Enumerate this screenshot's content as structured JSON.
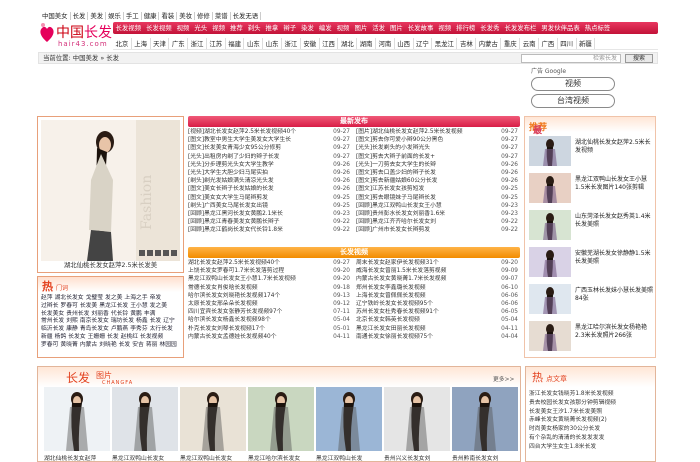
{
  "logo": {
    "cn_main": "中国",
    "cn_accent": "长发",
    "domain": "hair43.com"
  },
  "topnav": [
    "中国美女",
    "长发",
    "美发",
    "娱乐",
    "手工",
    "健康",
    "看装",
    "美妆",
    "修修",
    "菜谱",
    "长发无语"
  ],
  "nav2": [
    "长发视频",
    "长发视频",
    "视频",
    "光头",
    "视频",
    "推荐",
    "剃头",
    "推拿",
    "辫子",
    "染发",
    "编发",
    "视频",
    "图片",
    "活发",
    "图片",
    "长发故事",
    "视频",
    "排行榜",
    "长发秀",
    "长发发布栏",
    "男发伙伴品表",
    "热点标签"
  ],
  "nav3": [
    "北京",
    "上海",
    "天津",
    "广东",
    "浙江",
    "江苏",
    "福建",
    "山东",
    "山东",
    "浙江",
    "安徽",
    "江西",
    "湖北",
    "湖南",
    "河南",
    "山西",
    "辽宁",
    "黑龙江",
    "吉林",
    "内蒙古",
    "重庆",
    "云南",
    "广西",
    "四川",
    "新疆"
  ],
  "crumb": "当前位置: 中国美发 » 长发",
  "search": {
    "placeholder": "检索长发",
    "button": "搜索"
  },
  "ad": {
    "label": "广告 Google",
    "buttons": [
      "视频",
      "台湾视频"
    ]
  },
  "featured": {
    "caption": "湖北仙桃长发女赵萍2.5米长发美"
  },
  "sections": {
    "latest": "最新发布",
    "video": "长发视频"
  },
  "latest_left": [
    [
      "[视频]湖北长发女赵萍2.5米长发视频40个",
      "09-27"
    ],
    [
      "[图文]教室中男生大学生美发女大学生长",
      "09-27"
    ],
    [
      "[图文]长发美女青海少女95公分修剪",
      "09-27"
    ],
    [
      "[光头]出租房内剃了少妇的辫子长发",
      "09-27"
    ],
    [
      "[光头]分步理剪光头女大学生教学",
      "09-26"
    ],
    [
      "[光头]大学生大胆少妇马尾实拍",
      "09-26"
    ],
    [
      "[剃头]剃光发姑娘满头清凉光头发",
      "09-26"
    ],
    [
      "[图文]美女长辫子长发姑娘的长发",
      "09-26"
    ],
    [
      "[图文]美女女大学生马尾辫剪发",
      "09-25"
    ],
    [
      "[剃头]广西美女马尾长发女出镜",
      "09-25"
    ],
    [
      "[回顾]黑龙江黑河长发女黄鹏2.1米长",
      "09-23"
    ],
    [
      "[回顾]黑龙江青春美发女黄鹏长辫子",
      "09-22"
    ],
    [
      "[回顾]黑龙江鹤岗长发女代长铃1.8米",
      "09-22"
    ]
  ],
  "latest_right": [
    [
      "[图片]湖北仙桃长发女赵萍2.5米长发视频",
      "09-27"
    ],
    [
      "[图文]剪去你可爱小辫90公分黑色",
      "09-27"
    ],
    [
      "[光头]长发剃头的小发辫光头",
      "09-27"
    ],
    [
      "[图文]剪去大辫子前面的长发+",
      "09-27"
    ],
    [
      "[光头]一刀剪去女大学生的长辫",
      "09-26"
    ],
    [
      "[图文]剪去口盖少妇的辫子长发",
      "09-26"
    ],
    [
      "[图文]剪去新疆姑娘60公分长发",
      "09-26"
    ],
    [
      "[图文]江苏长发女孩剪短发",
      "09-25"
    ],
    [
      "[图文]剪去眼镜妹子马尾辫长发",
      "09-25"
    ],
    [
      "[回顾]黑龙江双鸭山长发女王小慧",
      "09-23"
    ],
    [
      "[回顾]贵州彭水长发女刘丽香1.6米",
      "09-23"
    ],
    [
      "[回顾]黑龙江齐齐哈尔长发女刘",
      "09-22"
    ],
    [
      "[回顾]广州市长发女长辫剪发",
      "09-22"
    ]
  ],
  "video_left": [
    [
      "湖北长发女赵萍2.5米长发视频40个",
      "09-27"
    ],
    [
      "上饶长发女罗春可1.7米长发落剪过程",
      "09-20"
    ],
    [
      "黑龙江双鸭山长发女王小慧1.7米长发视频",
      "09-20"
    ],
    [
      "常德长发女肖俊晗长发视频",
      "09-18"
    ],
    [
      "哈尔滨长发女刘晓艳长发视频174个",
      "09-13"
    ],
    [
      "太原长发女邢朵朵长发视频",
      "09-12"
    ],
    [
      "四川宜宾长发女张静芳长发视频97个",
      "07-11"
    ],
    [
      "哈尔滨长发女杨鑫长发视频98个",
      "05-04"
    ],
    [
      "朴克长发女刘琴长发视频17个",
      "05-01"
    ],
    [
      "内蒙古长发女孟德娃长发视频40个",
      "04-11"
    ]
  ],
  "video_right": [
    [
      "周末长发女赵家伊长发视频31个",
      "09-20"
    ],
    [
      "威海长发女曾丽1.5米长发落剪视频",
      "09-09"
    ],
    [
      "内蒙古长发女黄晓菁1.7米长发视频",
      "09-07"
    ],
    [
      "郑州长发女李鑫璐长发视频",
      "06-10"
    ],
    [
      "上海长发女曾佩佩长发视频",
      "06-06"
    ],
    [
      "辽宁铁岭长发女长发视频95个",
      "06-06"
    ],
    [
      "苏州长发女杜秀春长发视频91个",
      "06-05"
    ],
    [
      "北京长发女韩英长发视频",
      "05-04"
    ],
    [
      "黑龙江长发女田丽长发视频",
      "04-11"
    ],
    [
      "南通长发女徐丽长发视频75个",
      "04-04"
    ]
  ],
  "hot": {
    "title_char": "热",
    "title_rest": "门词",
    "tags": [
      "赵萍",
      "湖北长发女",
      "戈璧莹",
      "发之美",
      "上海之手",
      "帝发",
      "过辫长",
      "罗春可",
      "长发美",
      "黑龙江长发",
      "王小慧",
      "发之美",
      "长发美女",
      "贵州长发",
      "刘丽香",
      "代长铃",
      "黄鹏",
      "丰满",
      "常州长发",
      "刘熙",
      "南京长发女",
      "瑞坊长发",
      "杨鑫",
      "长发",
      "辽宁",
      "临沂长发",
      "康静",
      "青岛长发女",
      "卢鹏燕",
      "李秀芬",
      "太行长发",
      "新疆",
      "杨鸽",
      "长发女",
      "王姗姗",
      "长发",
      "赵桃红",
      "长发视频",
      "罗春可",
      "黄晓菁",
      "内蒙古",
      "刘晓艳",
      "长发",
      "安吉",
      "蒋丽",
      "林园园"
    ]
  },
  "recommend": {
    "title_a": "最新",
    "title_b": "推荐",
    "items": [
      "湖北仙桃长发女赵萍2.5米长发视频",
      "黑龙江双鸭山长发女王小慧1.5米长发图片140张剪辑",
      "山东菏泽长发女赵秀英1.4米长发美照",
      "安徽芜湖长发女徐静静1.5米长发美照",
      "广西玉林长发妹小慧长发美照84张",
      "黑龙江哈尔滨长发女杨艳艳2.3米长发照片266张"
    ]
  },
  "gallery": {
    "title": "长发",
    "sub": "图片",
    "en": "CHANGFA",
    "more": "更多>>",
    "items": [
      "湖北仙桃长发女赵萍",
      "黑龙江双鸭山长发女",
      "黑龙江双鸭山长发女",
      "黑龙江哈尔滨长发女",
      "黑龙江双鸭山长发",
      "贵州兴义长发女刘",
      "贵州黔南长发女刘"
    ]
  },
  "articles": {
    "title_char": "热",
    "title_rest": "点文章",
    "items": [
      "浙江长发女钱晓芳1.8米长发视频",
      "贵去校园长发女孩那分钟剪辑视频",
      "长发美女王汐1.7米长发美照",
      "赤峰长发女黄晓菁长发视频(2)",
      "时尚美女杨家的30公分长发",
      "有个杂乱的清清的长发发发发",
      "四台大学生女生1.8米长发"
    ]
  },
  "colors": {
    "brand": "#d81e47",
    "accent": "#f28c00",
    "hot": "#e3421f"
  }
}
